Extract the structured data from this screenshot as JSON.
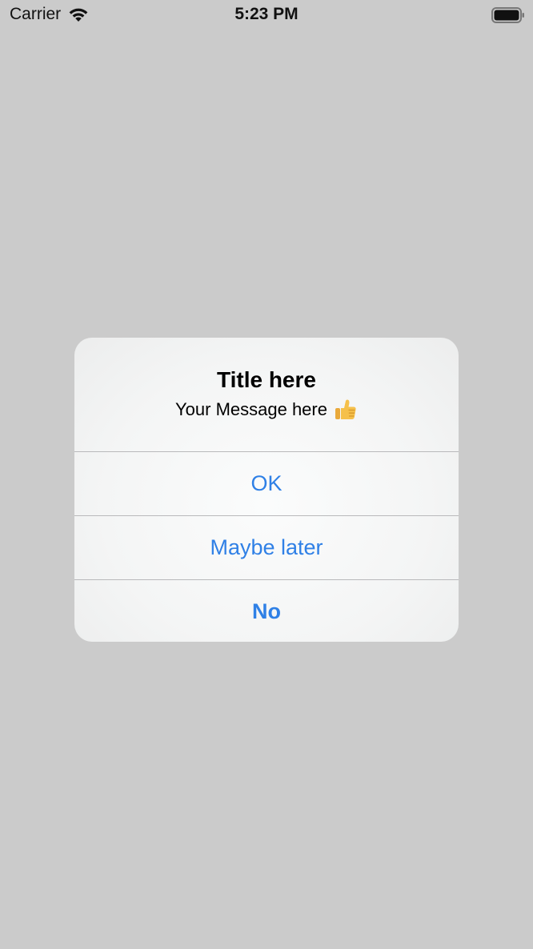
{
  "status_bar": {
    "carrier": "Carrier",
    "time": "5:23 PM"
  },
  "alert": {
    "title": "Title here",
    "message": "Your Message here",
    "message_icon": "thumbs-up-emoji",
    "buttons": [
      {
        "label": "OK",
        "style": "default"
      },
      {
        "label": "Maybe later",
        "style": "default"
      },
      {
        "label": "No",
        "style": "bold"
      }
    ],
    "accent_color": "#2f80e6"
  },
  "colors": {
    "backdrop": "#cbcbcb",
    "alert_background": "#f4f5f5",
    "separator": "#b9b9bb"
  }
}
